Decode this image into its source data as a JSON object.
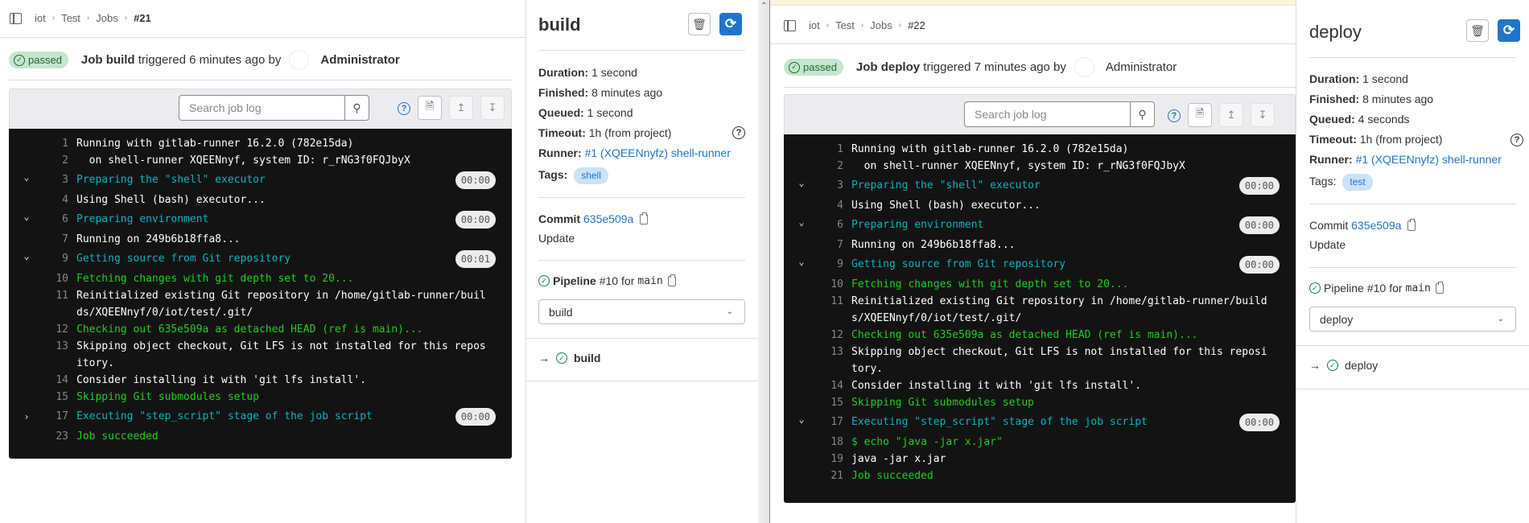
{
  "panes": [
    {
      "breadcrumb": [
        "iot",
        "Test",
        "Jobs",
        "#21"
      ],
      "status_badge": "passed",
      "header": {
        "prefix": "Job",
        "job": "build",
        "text": "triggered 6 minutes ago by",
        "user": "Administrator"
      },
      "search": {
        "placeholder": "Search job log"
      },
      "log": [
        {
          "n": "1",
          "text": "Running with gitlab-runner 16.2.0 (782e15da)",
          "color": "white"
        },
        {
          "n": "2",
          "text": "  on shell-runner XQEENnyf, system ID: r_rNG3f0FQJbyX",
          "color": "white"
        },
        {
          "n": "3",
          "text": "Preparing the \"shell\" executor",
          "color": "cyan",
          "section": true,
          "toggle": "expanded",
          "duration": "00:00"
        },
        {
          "n": "4",
          "text": "Using Shell (bash) executor...",
          "color": "white"
        },
        {
          "n": "6",
          "text": "Preparing environment",
          "color": "cyan",
          "section": true,
          "toggle": "expanded",
          "duration": "00:00"
        },
        {
          "n": "7",
          "text": "Running on 249b6b18ffa8...",
          "color": "white"
        },
        {
          "n": "9",
          "text": "Getting source from Git repository",
          "color": "cyan",
          "section": true,
          "toggle": "expanded",
          "duration": "00:01"
        },
        {
          "n": "10",
          "text": "Fetching changes with git depth set to 20...",
          "color": "green"
        },
        {
          "n": "11",
          "text": "Reinitialized existing Git repository in /home/gitlab-runner/builds/XQEENnyf/0/iot/test/.git/",
          "color": "white"
        },
        {
          "n": "12",
          "text": "Checking out 635e509a as detached HEAD (ref is main)...",
          "color": "green"
        },
        {
          "n": "13",
          "text": "Skipping object checkout, Git LFS is not installed for this repository.",
          "color": "white"
        },
        {
          "n": "14",
          "text": "Consider installing it with 'git lfs install'.",
          "color": "white"
        },
        {
          "n": "15",
          "text": "Skipping Git submodules setup",
          "color": "green"
        },
        {
          "n": "17",
          "text": "Executing \"step_script\" stage of the job script",
          "color": "cyan",
          "section": true,
          "toggle": "collapsed",
          "duration": "00:00"
        },
        {
          "n": "23",
          "text": "Job succeeded",
          "color": "green"
        }
      ],
      "sidebar": {
        "title": "build",
        "duration_label": "Duration:",
        "duration": "1 second",
        "finished_label": "Finished:",
        "finished": "8 minutes ago",
        "queued_label": "Queued:",
        "queued": "1 second",
        "timeout_label": "Timeout:",
        "timeout": "1h (from project)",
        "runner_label": "Runner:",
        "runner": "#1 (XQEENnyfz) shell-runner",
        "tags_label": "Tags:",
        "tag": "shell",
        "commit_label": "Commit",
        "commit_sha": "635e509a",
        "commit_msg": "Update",
        "pipeline_label": "Pipeline",
        "pipeline_id": "#10",
        "pipeline_for": "for",
        "pipeline_ref": "main",
        "stage_select": "build",
        "job_item": "build"
      }
    },
    {
      "breadcrumb": [
        "iot",
        "Test",
        "Jobs",
        "#22"
      ],
      "status_badge": "passed",
      "header": {
        "prefix": "Job",
        "job": "deploy",
        "text": "triggered 7 minutes ago by",
        "user": "Administrator"
      },
      "search": {
        "placeholder": "Search job log"
      },
      "log": [
        {
          "n": "1",
          "text": "Running with gitlab-runner 16.2.0 (782e15da)",
          "color": "white"
        },
        {
          "n": "2",
          "text": "  on shell-runner XQEENnyf, system ID: r_rNG3f0FQJbyX",
          "color": "white"
        },
        {
          "n": "3",
          "text": "Preparing the \"shell\" executor",
          "color": "cyan",
          "section": true,
          "toggle": "expanded",
          "duration": "00:00"
        },
        {
          "n": "4",
          "text": "Using Shell (bash) executor...",
          "color": "white"
        },
        {
          "n": "6",
          "text": "Preparing environment",
          "color": "cyan",
          "section": true,
          "toggle": "expanded",
          "duration": "00:00"
        },
        {
          "n": "7",
          "text": "Running on 249b6b18ffa8...",
          "color": "white"
        },
        {
          "n": "9",
          "text": "Getting source from Git repository",
          "color": "cyan",
          "section": true,
          "toggle": "expanded",
          "duration": "00:00"
        },
        {
          "n": "10",
          "text": "Fetching changes with git depth set to 20...",
          "color": "green"
        },
        {
          "n": "11",
          "text": "Reinitialized existing Git repository in /home/gitlab-runner/builds/XQEENnyf/0/iot/test/.git/",
          "color": "white"
        },
        {
          "n": "12",
          "text": "Checking out 635e509a as detached HEAD (ref is main)...",
          "color": "green"
        },
        {
          "n": "13",
          "text": "Skipping object checkout, Git LFS is not installed for this repository.",
          "color": "white"
        },
        {
          "n": "14",
          "text": "Consider installing it with 'git lfs install'.",
          "color": "white"
        },
        {
          "n": "15",
          "text": "Skipping Git submodules setup",
          "color": "green"
        },
        {
          "n": "17",
          "text": "Executing \"step_script\" stage of the job script",
          "color": "cyan",
          "section": true,
          "toggle": "expanded",
          "duration": "00:00"
        },
        {
          "n": "18",
          "text": "$ echo \"java -jar x.jar\"",
          "color": "green"
        },
        {
          "n": "19",
          "text": "java -jar x.jar",
          "color": "white"
        },
        {
          "n": "21",
          "text": "Job succeeded",
          "color": "green"
        }
      ],
      "sidebar": {
        "title": "deploy",
        "duration_label": "Duration:",
        "duration": "1 second",
        "finished_label": "Finished:",
        "finished": "8 minutes ago",
        "queued_label": "Queued:",
        "queued": "4 seconds",
        "timeout_label": "Timeout:",
        "timeout": "1h (from project)",
        "runner_label": "Runner:",
        "runner": "#1 (XQEENnyfz) shell-runner",
        "tags_label": "Tags:",
        "tag": "test",
        "commit_label": "Commit",
        "commit_sha": "635e509a",
        "commit_msg": "Update",
        "pipeline_label": "Pipeline",
        "pipeline_id": "#10",
        "pipeline_for": "for",
        "pipeline_ref": "main",
        "stage_select": "deploy",
        "job_item": "deploy"
      }
    }
  ],
  "icons": {
    "toggle_expanded": "⌄",
    "toggle_collapsed": "›",
    "check": "✓",
    "arrow": "→"
  },
  "colors": {
    "accent": "#1f75cb",
    "success": "#108548",
    "log_bg": "#131313",
    "log_cyan": "#05b4c0",
    "log_green": "#1bcf1b"
  }
}
